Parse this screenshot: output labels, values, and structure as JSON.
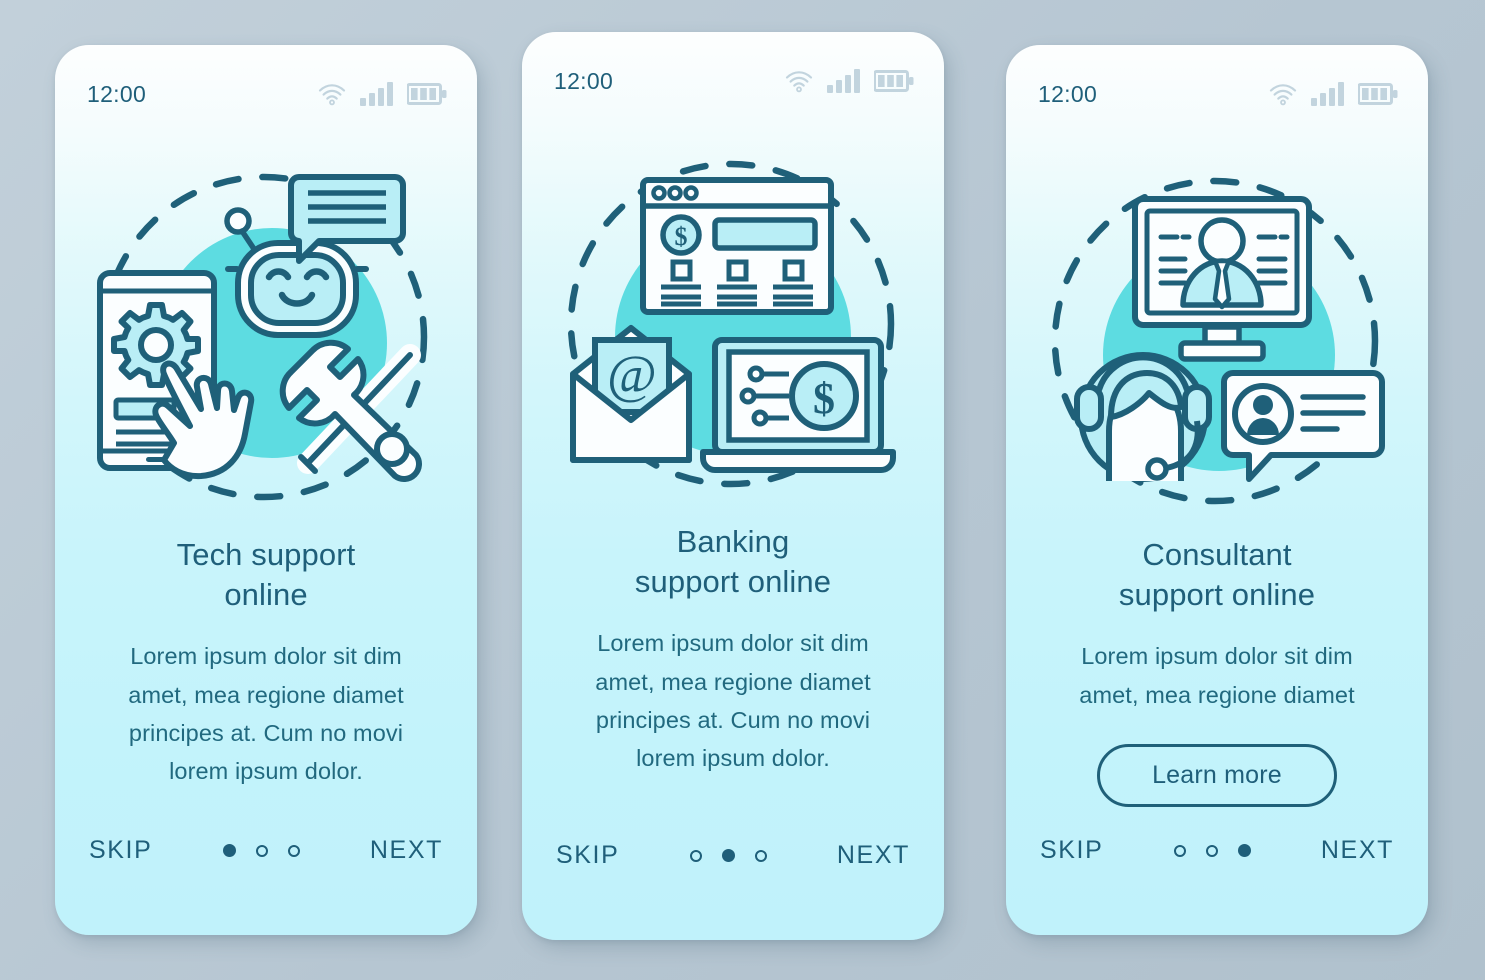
{
  "theme": {
    "page_background": "#b6c6d2",
    "card_top_color": "#fdfefe",
    "card_bottom_color": "#c0f2fb",
    "accent_circle": "#5ddce1",
    "stroke_color": "#1f6079",
    "text_color": "#1f5f7a",
    "light_fill": "#d3f4fa",
    "status_icon_color": "#c2d4de"
  },
  "cards": [
    {
      "id": "tech-support",
      "statusbar": {
        "time": "12:00",
        "icons": [
          "wifi-icon",
          "signal-icon",
          "battery-icon"
        ]
      },
      "illustration": {
        "name": "tech-support-illustration",
        "elements": [
          "smartphone-icon",
          "gear-icon",
          "hand-pointer-icon",
          "chatbot-icon",
          "chat-bubble-icon",
          "wrench-icon",
          "screwdriver-icon",
          "dashed-circle",
          "teal-circle"
        ]
      },
      "title": "Tech support\nonline",
      "description": "Lorem ipsum dolor sit dim\namet, mea regione diamet\nprincipes at. Cum no movi\nlorem ipsum dolor.",
      "cta": null,
      "nav": {
        "skip_label": "SKIP",
        "next_label": "NEXT",
        "dots_total": 3,
        "active_dot": 0
      }
    },
    {
      "id": "banking-support",
      "statusbar": {
        "time": "12:00",
        "icons": [
          "wifi-icon",
          "signal-icon",
          "battery-icon"
        ]
      },
      "illustration": {
        "name": "banking-support-illustration",
        "elements": [
          "browser-window-icon",
          "dollar-coin-icon",
          "email-envelope-icon",
          "at-sign-icon",
          "laptop-icon",
          "payment-nodes-icon",
          "dashed-circle",
          "teal-circle"
        ]
      },
      "title": "Banking\nsupport online",
      "description": "Lorem ipsum dolor sit dim\namet, mea regione diamet\nprincipes at. Cum no movi\nlorem ipsum dolor.",
      "cta": null,
      "nav": {
        "skip_label": "SKIP",
        "next_label": "NEXT",
        "dots_total": 3,
        "active_dot": 1
      }
    },
    {
      "id": "consultant-support",
      "statusbar": {
        "time": "12:00",
        "icons": [
          "wifi-icon",
          "signal-icon",
          "battery-icon"
        ]
      },
      "illustration": {
        "name": "consultant-support-illustration",
        "elements": [
          "desktop-monitor-icon",
          "person-profile-icon",
          "headset-operator-icon",
          "chat-bubble-avatar-icon",
          "dashed-circle",
          "teal-circle"
        ]
      },
      "title": "Consultant\nsupport online",
      "description": "Lorem ipsum dolor sit dim\namet, mea regione diamet",
      "cta": {
        "label": "Learn more"
      },
      "nav": {
        "skip_label": "SKIP",
        "next_label": "NEXT",
        "dots_total": 3,
        "active_dot": 2
      }
    }
  ]
}
